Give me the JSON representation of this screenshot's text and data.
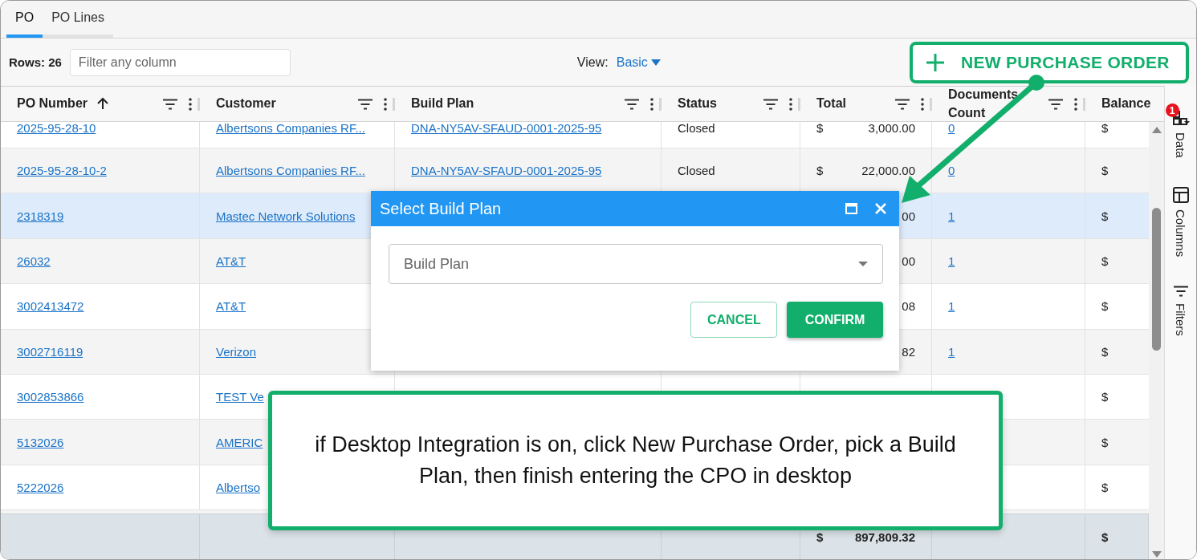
{
  "tabs": [
    {
      "label": "PO",
      "selected": true
    },
    {
      "label": "PO Lines",
      "selected": false
    }
  ],
  "toolbar": {
    "rows_label": "Rows: 26",
    "filter": {
      "placeholder": "Filter any column"
    },
    "view_label": "View:",
    "view_value": "Basic",
    "new_button": "NEW PURCHASE ORDER"
  },
  "table": {
    "columns": [
      {
        "label": "PO Number",
        "sorted": true,
        "menu": true
      },
      {
        "label": "Customer",
        "sorted": false,
        "menu": true
      },
      {
        "label": "Build Plan",
        "sorted": false,
        "menu": true
      },
      {
        "label": "Status",
        "sorted": false,
        "menu": true
      },
      {
        "label": "Total",
        "sorted": false,
        "menu": true
      },
      {
        "label": "Documents Count",
        "sorted": false,
        "menu": true
      },
      {
        "label": "Balance",
        "sorted": false,
        "menu": false
      }
    ],
    "rows": [
      {
        "po": "2025-95-28-10",
        "customer": "Albertsons Companies RF...",
        "build_plan": "DNA-NY5AV-SFAUD-0001-2025-95",
        "status": "Closed",
        "currency": "$",
        "total": "3,000.00",
        "documents": "0",
        "balance": "$",
        "selected": false
      },
      {
        "po": "2025-95-28-10-2",
        "customer": "Albertsons Companies RF...",
        "build_plan": "DNA-NY5AV-SFAUD-0001-2025-95",
        "status": "Closed",
        "currency": "$",
        "total": "22,000.00",
        "documents": "0",
        "balance": "$",
        "selected": false
      },
      {
        "po": "2318319",
        "customer": "Mastec Network Solutions",
        "total": "00",
        "documents": "1",
        "balance": "$",
        "selected": true
      },
      {
        "po": "26032",
        "customer": "AT&T",
        "total": "00",
        "documents": "1",
        "balance": "$",
        "selected": false
      },
      {
        "po": "3002413472",
        "customer": "AT&T",
        "total": "08",
        "documents": "1",
        "balance": "$",
        "selected": false
      },
      {
        "po": "3002716119",
        "customer": "Verizon",
        "total": "82",
        "documents": "1",
        "balance": "$",
        "selected": false
      },
      {
        "po": "3002853866",
        "customer": "TEST Ve",
        "balance": "$",
        "selected": false
      },
      {
        "po": "5132026",
        "customer": "AMERIC",
        "balance": "$",
        "selected": false
      },
      {
        "po": "5222026",
        "customer": "Albertso",
        "balance": "$",
        "selected": false
      }
    ],
    "footer": {
      "currency": "$",
      "total": "897,809.32",
      "balance": "$"
    }
  },
  "side_panel": [
    {
      "label": "Data",
      "kind": "data",
      "badge": "1"
    },
    {
      "label": "Columns",
      "kind": "columns"
    },
    {
      "label": "Filters",
      "kind": "filters"
    }
  ],
  "dialog": {
    "title": "Select Build Plan",
    "field": {
      "placeholder": "Build Plan"
    },
    "buttons": [
      {
        "label": "CANCEL",
        "kind": "outlined"
      },
      {
        "label": "CONFIRM",
        "kind": "filled"
      }
    ]
  },
  "callout": {
    "text": "if Desktop Integration is on, click New Purchase Order, pick a Build Plan, then finish entering the CPO in desktop"
  }
}
